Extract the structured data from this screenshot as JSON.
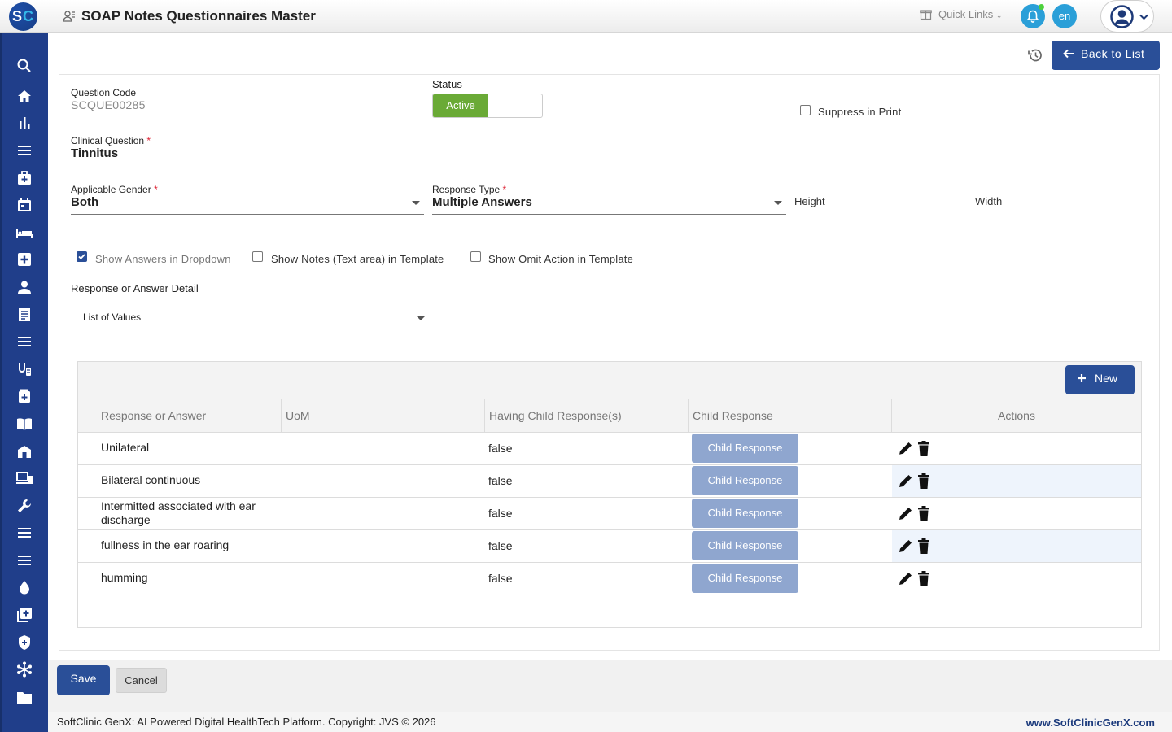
{
  "header": {
    "logo_text_s": "S",
    "logo_text_c": "C",
    "title": "SOAP Notes Questionnaires Master",
    "quick_links": "Quick Links",
    "language": "en"
  },
  "sidebar": {
    "items": [
      "search-icon",
      "home-icon",
      "bar-chart-icon",
      "menu-icon",
      "medical-bag-icon",
      "calendar-icon",
      "bed-icon",
      "medical-plus-icon",
      "person-icon",
      "receipt-icon",
      "list-icon",
      "lab-icon",
      "pharmacy-icon",
      "book-icon",
      "building-icon",
      "devices-icon",
      "wrench-icon",
      "list-icon-2",
      "list-icon-3",
      "drop-icon",
      "add-box-icon",
      "shield-icon",
      "hub-icon",
      "folder-icon"
    ]
  },
  "toolbar": {
    "back_label": "Back to List"
  },
  "form": {
    "question_code_label": "Question Code",
    "question_code_value": "SCQUE00285",
    "status_label": "Status",
    "status_value": "Active",
    "suppress_label": "Suppress in Print",
    "clinical_question_label": "Clinical Question",
    "clinical_question_value": "Tinnitus",
    "gender_label": "Applicable Gender",
    "gender_value": "Both",
    "response_type_label": "Response Type",
    "response_type_value": "Multiple Answers",
    "height_placeholder": "Height",
    "width_placeholder": "Width",
    "show_dropdown_label": "Show Answers in Dropdown",
    "show_notes_label": "Show Notes (Text area) in Template",
    "show_omit_label": "Show Omit Action in Template",
    "response_detail_label": "Response or Answer Detail",
    "response_detail_value": "List of Values",
    "required_mark": "*"
  },
  "grid": {
    "new_label": "New",
    "columns": [
      "Response or Answer",
      "UoM",
      "Having Child Response(s)",
      "Child Response",
      "Actions"
    ],
    "rows": [
      {
        "answer": "Unilateral",
        "uom": "",
        "having_child": "false",
        "child_btn": "Child Response"
      },
      {
        "answer": "Bilateral continuous",
        "uom": "",
        "having_child": "false",
        "child_btn": "Child Response"
      },
      {
        "answer": "Intermitted associated with ear discharge",
        "uom": "",
        "having_child": "false",
        "child_btn": "Child Response"
      },
      {
        "answer": "fullness in the ear roaring",
        "uom": "",
        "having_child": "false",
        "child_btn": "Child Response"
      },
      {
        "answer": "humming",
        "uom": "",
        "having_child": "false",
        "child_btn": "Child Response"
      }
    ]
  },
  "actions": {
    "save_label": "Save",
    "cancel_label": "Cancel"
  },
  "footer": {
    "copyright": "SoftClinic GenX: AI Powered Digital HealthTech Platform. Copyright: JVS © 2026",
    "url": "www.SoftClinicGenX.com"
  },
  "colors": {
    "primary": "#2a4f98",
    "sidebar": "#203e8a",
    "status_active": "#6aaa36",
    "child_btn": "#8fa6cf",
    "notification": "#2a9fd8"
  }
}
